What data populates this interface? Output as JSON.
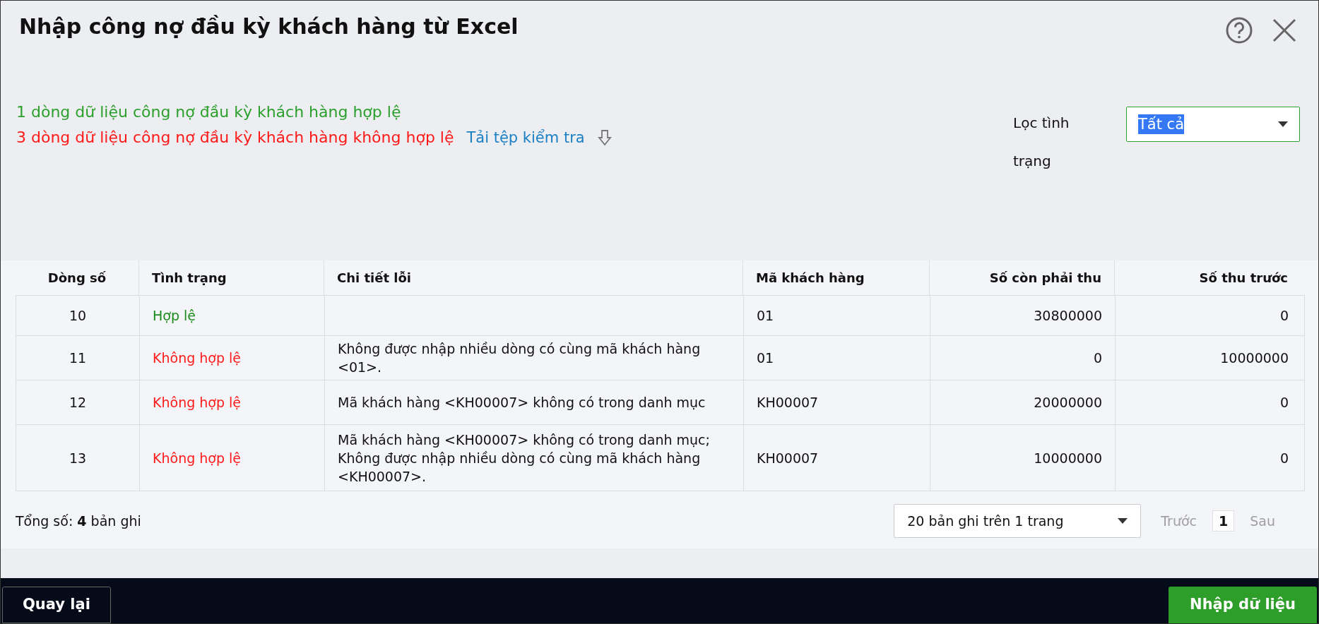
{
  "dialog": {
    "title": "Nhập công nợ đầu kỳ khách hàng từ Excel"
  },
  "summary": {
    "valid_message": "1 dòng dữ liệu công nợ đầu kỳ khách hàng hợp lệ",
    "invalid_message": "3 dòng dữ liệu công nợ đầu kỳ khách hàng không hợp lệ",
    "download_link": "Tải tệp kiểm tra"
  },
  "filter": {
    "label": "Lọc tình trạng",
    "value": "Tất cả"
  },
  "table": {
    "columns": [
      "Dòng số",
      "Tình trạng",
      "Chi tiết lỗi",
      "Mã khách hàng",
      "Số còn phải thu",
      "Số thu trước"
    ],
    "rows": [
      {
        "line": "10",
        "status": "Hợp lệ",
        "valid": true,
        "error": "",
        "customer_code": "01",
        "receivable": "30800000",
        "prepaid": "0"
      },
      {
        "line": "11",
        "status": "Không hợp lệ",
        "valid": false,
        "error": "Không được nhập nhiều dòng có cùng mã khách hàng <01>.",
        "customer_code": "01",
        "receivable": "0",
        "prepaid": "10000000"
      },
      {
        "line": "12",
        "status": "Không hợp lệ",
        "valid": false,
        "error": "Mã khách hàng <KH00007> không có trong danh mục",
        "customer_code": "KH00007",
        "receivable": "20000000",
        "prepaid": "0"
      },
      {
        "line": "13",
        "status": "Không hợp lệ",
        "valid": false,
        "error": "Mã khách hàng <KH00007> không có trong danh mục; Không được nhập nhiều dòng có cùng mã khách hàng <KH00007>.",
        "customer_code": "KH00007",
        "receivable": "10000000",
        "prepaid": "0"
      }
    ]
  },
  "pagination": {
    "total": "Tổng số: **4** bản ghi",
    "page_size": "20 bản ghi trên 1 trang",
    "previous": {
      "label": "Trước",
      "disabled": true
    },
    "pages": [
      {
        "label": "1",
        "selected": true
      }
    ],
    "next": {
      "label": "Sau",
      "disabled": true
    }
  },
  "footer": {
    "back_button": "Quay lại",
    "import_button": "Nhập dữ liệu"
  }
}
